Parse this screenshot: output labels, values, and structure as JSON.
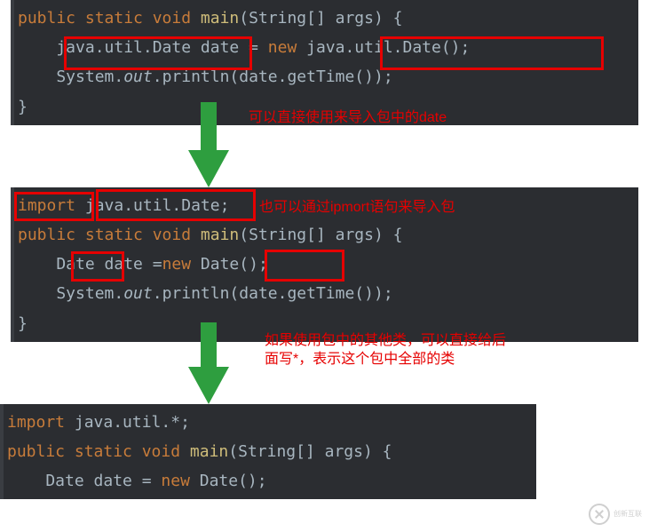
{
  "blocks": {
    "b1": {
      "lines": [
        {
          "tokens": [
            {
              "cls": "kw",
              "t": "public static void "
            },
            {
              "cls": "method",
              "t": "main"
            },
            {
              "cls": "norm",
              "t": "(String[] args) {"
            }
          ]
        },
        {
          "tokens": [
            {
              "cls": "norm",
              "t": "    java.util.Date date = "
            },
            {
              "cls": "kw",
              "t": "new "
            },
            {
              "cls": "norm",
              "t": "java.util.Date();"
            }
          ]
        },
        {
          "tokens": [
            {
              "cls": "norm",
              "t": "    System."
            },
            {
              "cls": "norm ital",
              "t": "out"
            },
            {
              "cls": "norm",
              "t": ".println(date.getTime());"
            }
          ]
        },
        {
          "tokens": [
            {
              "cls": "norm",
              "t": "}"
            }
          ]
        }
      ],
      "annotation": "可以直接使用来导入包中的date"
    },
    "b2": {
      "lines": [
        {
          "tokens": [
            {
              "cls": "kw",
              "t": "import "
            },
            {
              "cls": "norm",
              "t": "java.util.Date;"
            }
          ]
        },
        {
          "tokens": [
            {
              "cls": "kw",
              "t": "public static void "
            },
            {
              "cls": "method",
              "t": "main"
            },
            {
              "cls": "norm",
              "t": "(String[] args) {"
            }
          ]
        },
        {
          "tokens": [
            {
              "cls": "norm",
              "t": "    Date date ="
            },
            {
              "cls": "kw",
              "t": "new "
            },
            {
              "cls": "norm",
              "t": "Date();"
            }
          ]
        },
        {
          "tokens": [
            {
              "cls": "norm",
              "t": "    System."
            },
            {
              "cls": "norm ital",
              "t": "out"
            },
            {
              "cls": "norm",
              "t": ".println(date.getTime());"
            }
          ]
        },
        {
          "tokens": [
            {
              "cls": "norm",
              "t": "}"
            }
          ]
        }
      ],
      "annotation": "也可以通过ipmort语句来导入包"
    },
    "b3": {
      "lines": [
        {
          "tokens": [
            {
              "cls": "kw",
              "t": "import "
            },
            {
              "cls": "norm",
              "t": "java.util.*;"
            }
          ]
        },
        {
          "tokens": [
            {
              "cls": "kw",
              "t": "public static void "
            },
            {
              "cls": "method",
              "t": "main"
            },
            {
              "cls": "norm",
              "t": "(String[] args) {"
            }
          ]
        },
        {
          "tokens": [
            {
              "cls": "norm",
              "t": "    Date date = "
            },
            {
              "cls": "kw",
              "t": "new "
            },
            {
              "cls": "norm",
              "t": "Date();"
            }
          ]
        }
      ],
      "annotation": "如果使用包中的其他类，可以直接给后面写*，表示这个包中全部的类"
    }
  },
  "watermark": "创新互联"
}
